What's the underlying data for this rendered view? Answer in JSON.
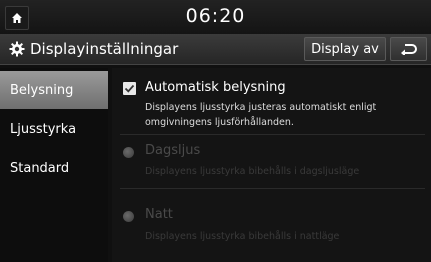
{
  "status": {
    "time": "06:20"
  },
  "header": {
    "title": "Displayinställningar",
    "display_off_label": "Display av"
  },
  "menu": {
    "items": [
      {
        "label": "Belysning",
        "active": true
      },
      {
        "label": "Ljusstyrka",
        "active": false
      },
      {
        "label": "Standard",
        "active": false
      }
    ]
  },
  "content": {
    "auto": {
      "label": "Automatisk belysning",
      "desc1": "Displayens ljusstyrka justeras automatiskt enligt",
      "desc2": "omgivningens ljusförhållanden.",
      "checked": true
    },
    "day": {
      "label": "Dagsljus",
      "desc": "Displayens ljusstyrka bibehålls i dagsljusläge",
      "enabled": false
    },
    "night": {
      "label": "Natt",
      "desc": "Displayens ljusstyrka bibehålls i nattläge",
      "enabled": false
    }
  },
  "colors": {
    "active_menu": "#8a8a8a",
    "disabled_text": "#4a4a4a"
  }
}
